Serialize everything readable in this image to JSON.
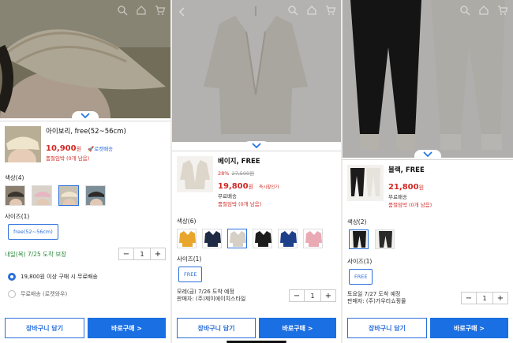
{
  "panels": [
    {
      "title": "아이보리, free(52~56cm)",
      "price": "10,900",
      "won": "원",
      "rocket": "🚀로켓배송",
      "stock": "품절임박 (0개 남음)",
      "color_label": "색상(4)",
      "size_label": "사이즈(1)",
      "size_value": "free(52~56cm)",
      "arrival": "내일(목) 7/25 도착 보장",
      "qty": "1",
      "option_free_ship": "19,800원 이상 구매 시 무료배송",
      "option_rocket_wow": "무료배송 (로켓와우)",
      "cart": "장바구니 담기",
      "buy": "바로구매 >"
    },
    {
      "title": "베이지, FREE",
      "discount": "28%",
      "orig_price": "27,500원",
      "price": "19,800",
      "won": "원",
      "instant": "즉시할인가",
      "shipping": "무료배송",
      "stock": "품절임박 (0개 남음)",
      "color_label": "색상(6)",
      "size_label": "사이즈(1)",
      "size_value": "FREE",
      "arrival": "모레(금) 7/26 도착 예정",
      "seller": "판매자: (주)제이에이치스타일",
      "qty": "1",
      "cart": "장바구니 담기",
      "buy": "바로구매 >"
    },
    {
      "title": "블랙, FREE",
      "price": "21,800",
      "won": "원",
      "shipping": "무료배송",
      "stock": "품절임박 (0개 남음)",
      "color_label": "색상(2)",
      "size_label": "사이즈(1)",
      "size_value": "FREE",
      "arrival": "토요일 7/27 도착 예정",
      "seller": "판매자: (주)가우리쇼핑몰",
      "qty": "1",
      "cart": "장바구니 담기",
      "buy": "바로구매 >"
    }
  ],
  "colors": {
    "accent": "#1a6fe3",
    "price": "#d12a25",
    "arrival_green": "#2c8a3a",
    "p2_swatches": [
      "#e8a62c",
      "#1f2a44",
      "#d6cfc5",
      "#1c1c1c",
      "#1e3f8a",
      "#e9aab4"
    ]
  }
}
